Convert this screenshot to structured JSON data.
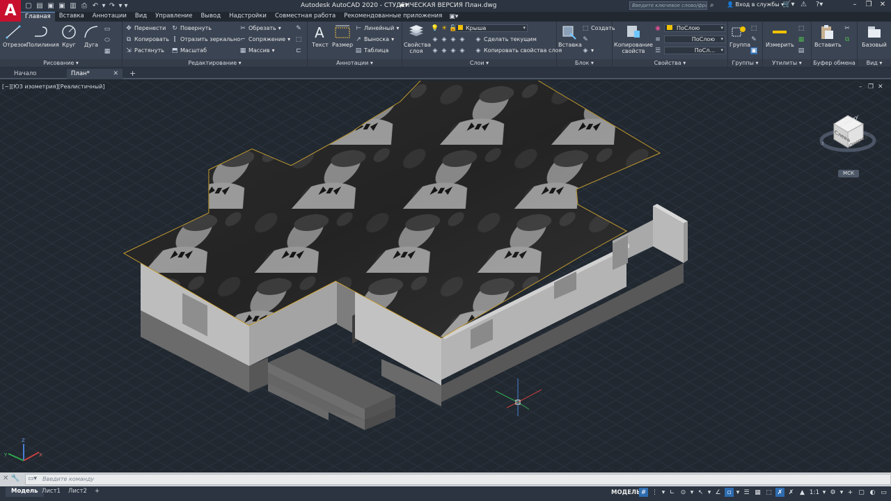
{
  "titlebar": {
    "app_logo": "A",
    "title": "Autodesk AutoCAD 2020 - СТУДЕНЧЕСКАЯ ВЕРСИЯ    План.dwg",
    "search_placeholder": "Введите ключевое слово/фразу",
    "user_label": "Вход в службы"
  },
  "ribbon_tabs": [
    "Главная",
    "Вставка",
    "Аннотации",
    "Вид",
    "Управление",
    "Вывод",
    "Надстройки",
    "Совместная работа",
    "Рекомендованные приложения"
  ],
  "ribbon": {
    "draw": {
      "title": "Рисование ▾",
      "line": "Отрезок",
      "polyline": "Полилиния",
      "circle": "Круг",
      "arc": "Дуга"
    },
    "modify": {
      "title": "Редактирование ▾",
      "move": "Перенести",
      "rotate": "Повернуть",
      "trim": "Обрезать",
      "copy": "Копировать",
      "mirror": "Отразить зеркально",
      "fillet": "Сопряжение",
      "stretch": "Растянуть",
      "scale": "Масштаб",
      "array": "Массив"
    },
    "annotation": {
      "title": "Аннотации ▾",
      "text": "Текст",
      "dimension": "Размер",
      "linear": "Линейный",
      "leader": "Выноска",
      "table": "Таблица"
    },
    "layers": {
      "title": "Слои ▾",
      "layer_props": "Свойства слоя",
      "current_layer": "Крыша",
      "make_current": "Сделать текущим",
      "match_layer": "Копировать свойства слоя"
    },
    "block": {
      "title": "Блок ▾",
      "insert": "Вставка",
      "create": "Создать"
    },
    "properties": {
      "title": "Свойства ▾",
      "match_props": "Копирование свойств",
      "color": "ПоСлою",
      "linetype": "ПоСлою",
      "lineweight": "ПоСл..."
    },
    "groups": {
      "title": "Группы ▾",
      "group": "Группа"
    },
    "utilities": {
      "title": "Утилиты ▾",
      "measure": "Измерить"
    },
    "clipboard": {
      "title": "Буфер обмена",
      "paste": "Вставить"
    },
    "view": {
      "title": "Вид ▾",
      "base": "Базовый"
    }
  },
  "doc_tabs": [
    "Начало",
    "План*"
  ],
  "viewport": {
    "label": "[−][ЮЗ изометрия][Реалистичный]",
    "viewcube_top": "Сверху",
    "viewcube_front": "Спереди",
    "viewcube_left": "Слева",
    "wcs": "МСК"
  },
  "command": {
    "placeholder": "Введите команду"
  },
  "layout_tabs": [
    "Модель",
    "Лист1",
    "Лист2"
  ],
  "status": {
    "model": "МОДЕЛЬ",
    "scale": "1:1"
  },
  "colors": {
    "background": "#212830",
    "ribbon": "#3b4453",
    "accent": "#2f6cb0",
    "logo": "#c8102e",
    "layer_swatch": "#f2c200"
  }
}
